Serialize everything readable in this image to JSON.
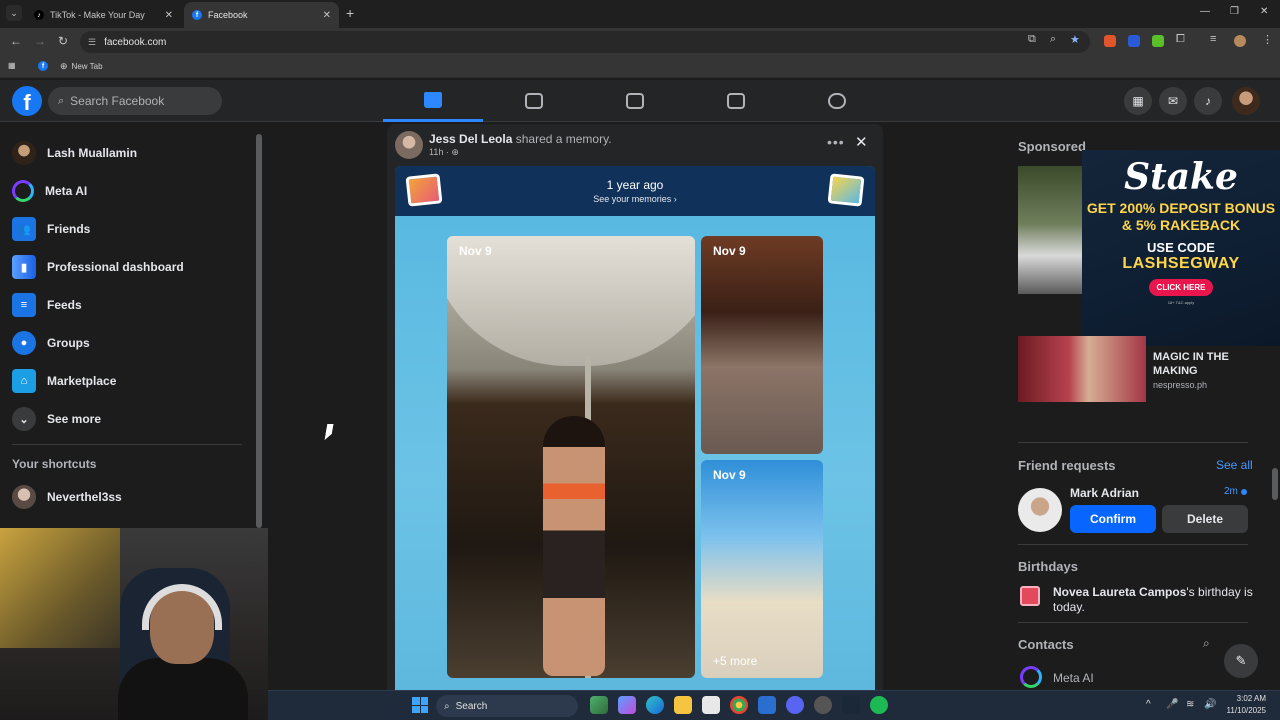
{
  "browser": {
    "tabs": [
      {
        "title": "TikTok - Make Your Day",
        "favicon": "tiktok-icon"
      },
      {
        "title": "Facebook",
        "favicon": "facebook-icon"
      }
    ],
    "url": "facebook.com",
    "bookmarks": [
      {
        "label": "",
        "icon": "facebook-icon"
      },
      {
        "label": "New Tab",
        "icon": "globe-icon"
      }
    ]
  },
  "fb": {
    "search_placeholder": "Search Facebook",
    "accent": "#0866ff"
  },
  "sidebar": {
    "items": [
      {
        "label": "Lash Muallamin",
        "icon": "profile-avatar"
      },
      {
        "label": "Meta AI",
        "icon": "meta-ai-icon"
      },
      {
        "label": "Friends",
        "icon": "friends-icon"
      },
      {
        "label": "Professional dashboard",
        "icon": "dashboard-icon"
      },
      {
        "label": "Feeds",
        "icon": "feeds-icon"
      },
      {
        "label": "Groups",
        "icon": "groups-icon"
      },
      {
        "label": "Marketplace",
        "icon": "marketplace-icon"
      },
      {
        "label": "See more",
        "icon": "chevron-down-icon"
      }
    ],
    "shortcuts_heading": "Your shortcuts",
    "shortcuts": [
      {
        "label": "Neverthel3ss"
      }
    ]
  },
  "post": {
    "author": "Jess Del Leola",
    "action": " shared a memory.",
    "time": "11h · ",
    "memory_title": "1 year ago",
    "memory_link": "See your memories",
    "photos": [
      {
        "date": "Nov 9"
      },
      {
        "date": "Nov 9"
      },
      {
        "date": "Nov 9",
        "more": "+5 more"
      }
    ]
  },
  "right": {
    "sponsored": "Sponsored",
    "stake_ad": {
      "brand": "Stake",
      "line1": "GET 200% DEPOSIT BONUS & 5% RAKEBACK",
      "line2": "USE CODE",
      "code": "LASHSEGWAY",
      "cta": "CLICK HERE",
      "fine": "18+ T&C apply"
    },
    "ad2": {
      "title": "MAGIC IN THE MAKING",
      "site": "nespresso.ph"
    },
    "friend_requests": {
      "heading": "Friend requests",
      "see_all": "See all",
      "name": "Mark Adrian",
      "time": "2m",
      "confirm": "Confirm",
      "delete": "Delete"
    },
    "birthdays": {
      "heading": "Birthdays",
      "name": "Novea Laureta Campos",
      "rest": "'s birthday is today."
    },
    "contacts": {
      "heading": "Contacts",
      "first": "Meta AI"
    }
  },
  "taskbar": {
    "search": "Search",
    "time": "3:02 AM",
    "date": "11/10/2025"
  }
}
